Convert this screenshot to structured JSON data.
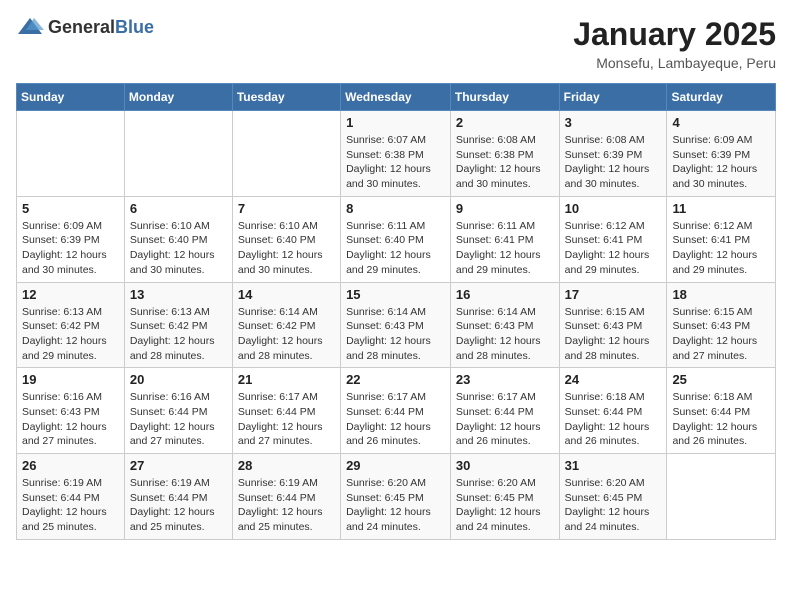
{
  "header": {
    "logo_general": "General",
    "logo_blue": "Blue",
    "title": "January 2025",
    "subtitle": "Monsefu, Lambayeque, Peru"
  },
  "days_of_week": [
    "Sunday",
    "Monday",
    "Tuesday",
    "Wednesday",
    "Thursday",
    "Friday",
    "Saturday"
  ],
  "weeks": [
    [
      {
        "day": "",
        "info": ""
      },
      {
        "day": "",
        "info": ""
      },
      {
        "day": "",
        "info": ""
      },
      {
        "day": "1",
        "info": "Sunrise: 6:07 AM\nSunset: 6:38 PM\nDaylight: 12 hours and 30 minutes."
      },
      {
        "day": "2",
        "info": "Sunrise: 6:08 AM\nSunset: 6:38 PM\nDaylight: 12 hours and 30 minutes."
      },
      {
        "day": "3",
        "info": "Sunrise: 6:08 AM\nSunset: 6:39 PM\nDaylight: 12 hours and 30 minutes."
      },
      {
        "day": "4",
        "info": "Sunrise: 6:09 AM\nSunset: 6:39 PM\nDaylight: 12 hours and 30 minutes."
      }
    ],
    [
      {
        "day": "5",
        "info": "Sunrise: 6:09 AM\nSunset: 6:39 PM\nDaylight: 12 hours and 30 minutes."
      },
      {
        "day": "6",
        "info": "Sunrise: 6:10 AM\nSunset: 6:40 PM\nDaylight: 12 hours and 30 minutes."
      },
      {
        "day": "7",
        "info": "Sunrise: 6:10 AM\nSunset: 6:40 PM\nDaylight: 12 hours and 30 minutes."
      },
      {
        "day": "8",
        "info": "Sunrise: 6:11 AM\nSunset: 6:40 PM\nDaylight: 12 hours and 29 minutes."
      },
      {
        "day": "9",
        "info": "Sunrise: 6:11 AM\nSunset: 6:41 PM\nDaylight: 12 hours and 29 minutes."
      },
      {
        "day": "10",
        "info": "Sunrise: 6:12 AM\nSunset: 6:41 PM\nDaylight: 12 hours and 29 minutes."
      },
      {
        "day": "11",
        "info": "Sunrise: 6:12 AM\nSunset: 6:41 PM\nDaylight: 12 hours and 29 minutes."
      }
    ],
    [
      {
        "day": "12",
        "info": "Sunrise: 6:13 AM\nSunset: 6:42 PM\nDaylight: 12 hours and 29 minutes."
      },
      {
        "day": "13",
        "info": "Sunrise: 6:13 AM\nSunset: 6:42 PM\nDaylight: 12 hours and 28 minutes."
      },
      {
        "day": "14",
        "info": "Sunrise: 6:14 AM\nSunset: 6:42 PM\nDaylight: 12 hours and 28 minutes."
      },
      {
        "day": "15",
        "info": "Sunrise: 6:14 AM\nSunset: 6:43 PM\nDaylight: 12 hours and 28 minutes."
      },
      {
        "day": "16",
        "info": "Sunrise: 6:14 AM\nSunset: 6:43 PM\nDaylight: 12 hours and 28 minutes."
      },
      {
        "day": "17",
        "info": "Sunrise: 6:15 AM\nSunset: 6:43 PM\nDaylight: 12 hours and 28 minutes."
      },
      {
        "day": "18",
        "info": "Sunrise: 6:15 AM\nSunset: 6:43 PM\nDaylight: 12 hours and 27 minutes."
      }
    ],
    [
      {
        "day": "19",
        "info": "Sunrise: 6:16 AM\nSunset: 6:43 PM\nDaylight: 12 hours and 27 minutes."
      },
      {
        "day": "20",
        "info": "Sunrise: 6:16 AM\nSunset: 6:44 PM\nDaylight: 12 hours and 27 minutes."
      },
      {
        "day": "21",
        "info": "Sunrise: 6:17 AM\nSunset: 6:44 PM\nDaylight: 12 hours and 27 minutes."
      },
      {
        "day": "22",
        "info": "Sunrise: 6:17 AM\nSunset: 6:44 PM\nDaylight: 12 hours and 26 minutes."
      },
      {
        "day": "23",
        "info": "Sunrise: 6:17 AM\nSunset: 6:44 PM\nDaylight: 12 hours and 26 minutes."
      },
      {
        "day": "24",
        "info": "Sunrise: 6:18 AM\nSunset: 6:44 PM\nDaylight: 12 hours and 26 minutes."
      },
      {
        "day": "25",
        "info": "Sunrise: 6:18 AM\nSunset: 6:44 PM\nDaylight: 12 hours and 26 minutes."
      }
    ],
    [
      {
        "day": "26",
        "info": "Sunrise: 6:19 AM\nSunset: 6:44 PM\nDaylight: 12 hours and 25 minutes."
      },
      {
        "day": "27",
        "info": "Sunrise: 6:19 AM\nSunset: 6:44 PM\nDaylight: 12 hours and 25 minutes."
      },
      {
        "day": "28",
        "info": "Sunrise: 6:19 AM\nSunset: 6:44 PM\nDaylight: 12 hours and 25 minutes."
      },
      {
        "day": "29",
        "info": "Sunrise: 6:20 AM\nSunset: 6:45 PM\nDaylight: 12 hours and 24 minutes."
      },
      {
        "day": "30",
        "info": "Sunrise: 6:20 AM\nSunset: 6:45 PM\nDaylight: 12 hours and 24 minutes."
      },
      {
        "day": "31",
        "info": "Sunrise: 6:20 AM\nSunset: 6:45 PM\nDaylight: 12 hours and 24 minutes."
      },
      {
        "day": "",
        "info": ""
      }
    ]
  ]
}
